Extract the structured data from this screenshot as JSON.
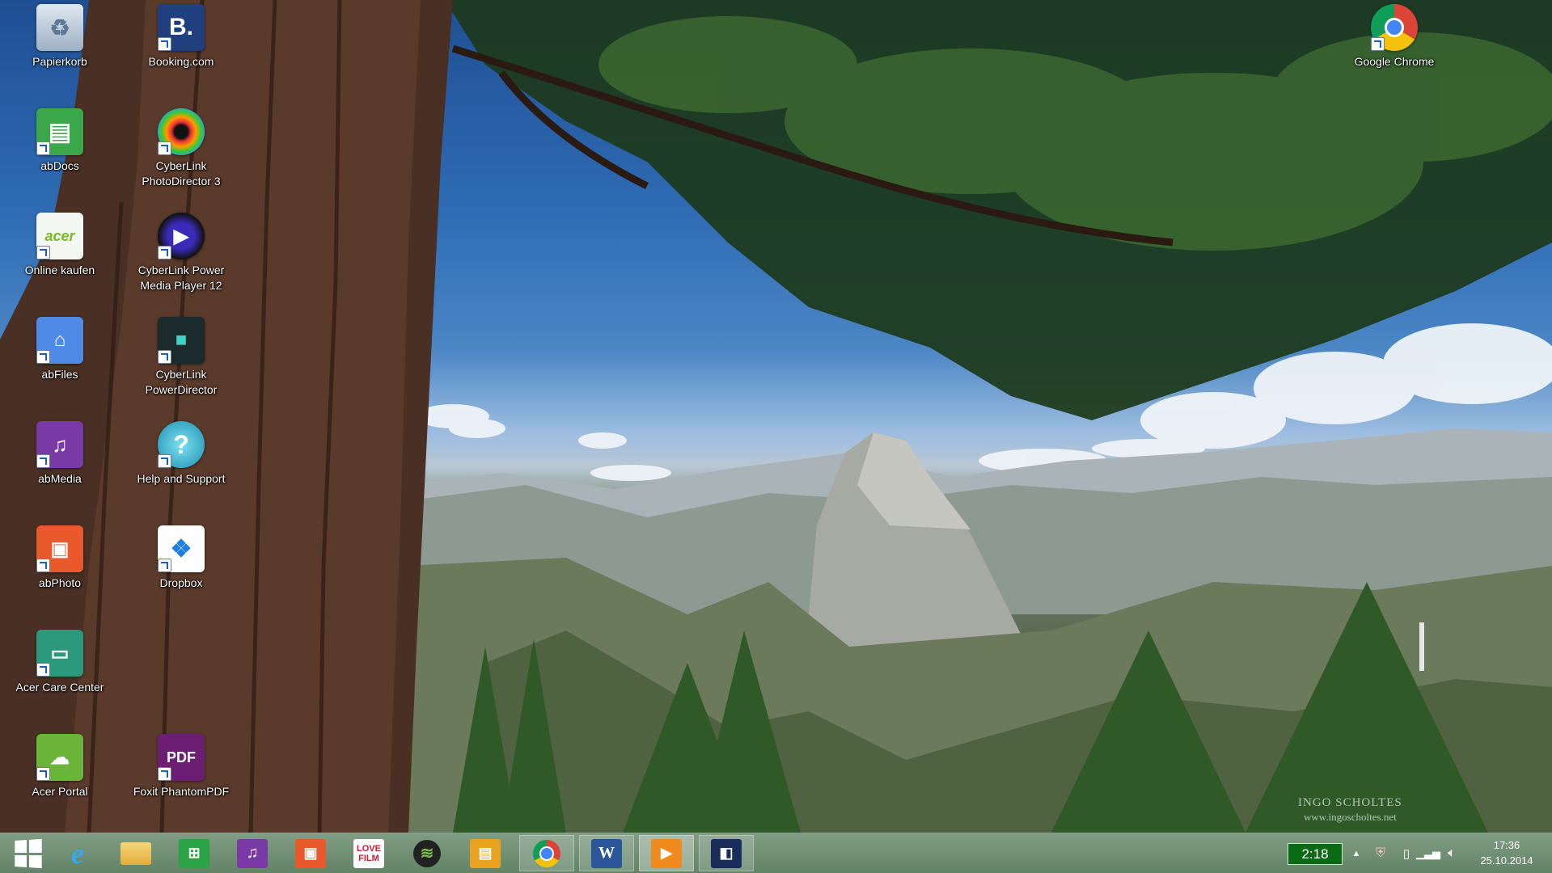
{
  "desktop": {
    "icons": [
      {
        "label": "Papierkorb",
        "icon": "recycle-bin-icon"
      },
      {
        "label": "Booking.com",
        "icon": "booking-icon"
      },
      {
        "label": "Google Chrome",
        "icon": "chrome-icon"
      },
      {
        "label": "abDocs",
        "icon": "abdocs-icon"
      },
      {
        "label": "CyberLink PhotoDirector 3",
        "icon": "photodirector-icon"
      },
      {
        "label": "Online kaufen",
        "icon": "acer-store-icon"
      },
      {
        "label": "CyberLink Power Media Player 12",
        "icon": "power-media-player-icon"
      },
      {
        "label": "abFiles",
        "icon": "abfiles-icon"
      },
      {
        "label": "CyberLink PowerDirector",
        "icon": "powerdirector-icon"
      },
      {
        "label": "abMedia",
        "icon": "abmedia-icon"
      },
      {
        "label": "Help and Support",
        "icon": "help-support-icon"
      },
      {
        "label": "abPhoto",
        "icon": "abphoto-icon"
      },
      {
        "label": "Dropbox",
        "icon": "dropbox-icon"
      },
      {
        "label": "Acer Care Center",
        "icon": "acer-care-center-icon"
      },
      {
        "label": "Acer Portal",
        "icon": "acer-portal-icon"
      },
      {
        "label": "Foxit PhantomPDF",
        "icon": "foxit-phantompdf-icon"
      }
    ],
    "watermark": {
      "name": "INGO SCHOLTES",
      "url": "www.ingoscholtes.net"
    }
  },
  "taskbar": {
    "pinned": [
      {
        "name": "start-button",
        "icon": "windows-logo-icon"
      },
      {
        "name": "internet-explorer",
        "icon": "internet-explorer-icon"
      },
      {
        "name": "file-explorer",
        "icon": "folder-icon"
      },
      {
        "name": "windows-store",
        "icon": "store-icon"
      },
      {
        "name": "abmedia",
        "icon": "abmedia-icon"
      },
      {
        "name": "abphoto",
        "icon": "abphoto-icon"
      },
      {
        "name": "lovefilm",
        "icon": "lovefilm-icon",
        "text": "LOVE FILM"
      },
      {
        "name": "spotify",
        "icon": "spotify-icon"
      },
      {
        "name": "abdocs",
        "icon": "abdocs-icon"
      },
      {
        "name": "google-chrome",
        "icon": "chrome-icon"
      },
      {
        "name": "microsoft-word",
        "icon": "word-icon",
        "text": "W"
      },
      {
        "name": "power-media-player",
        "icon": "media-player-icon"
      },
      {
        "name": "dolby",
        "icon": "dolby-icon"
      }
    ],
    "tray": {
      "battery_time": "2:18",
      "time": "17:36",
      "date": "25.10.2014"
    }
  },
  "colors": {
    "taskbar": "#5f8a64",
    "battery_indicator": "#0a6b14"
  }
}
